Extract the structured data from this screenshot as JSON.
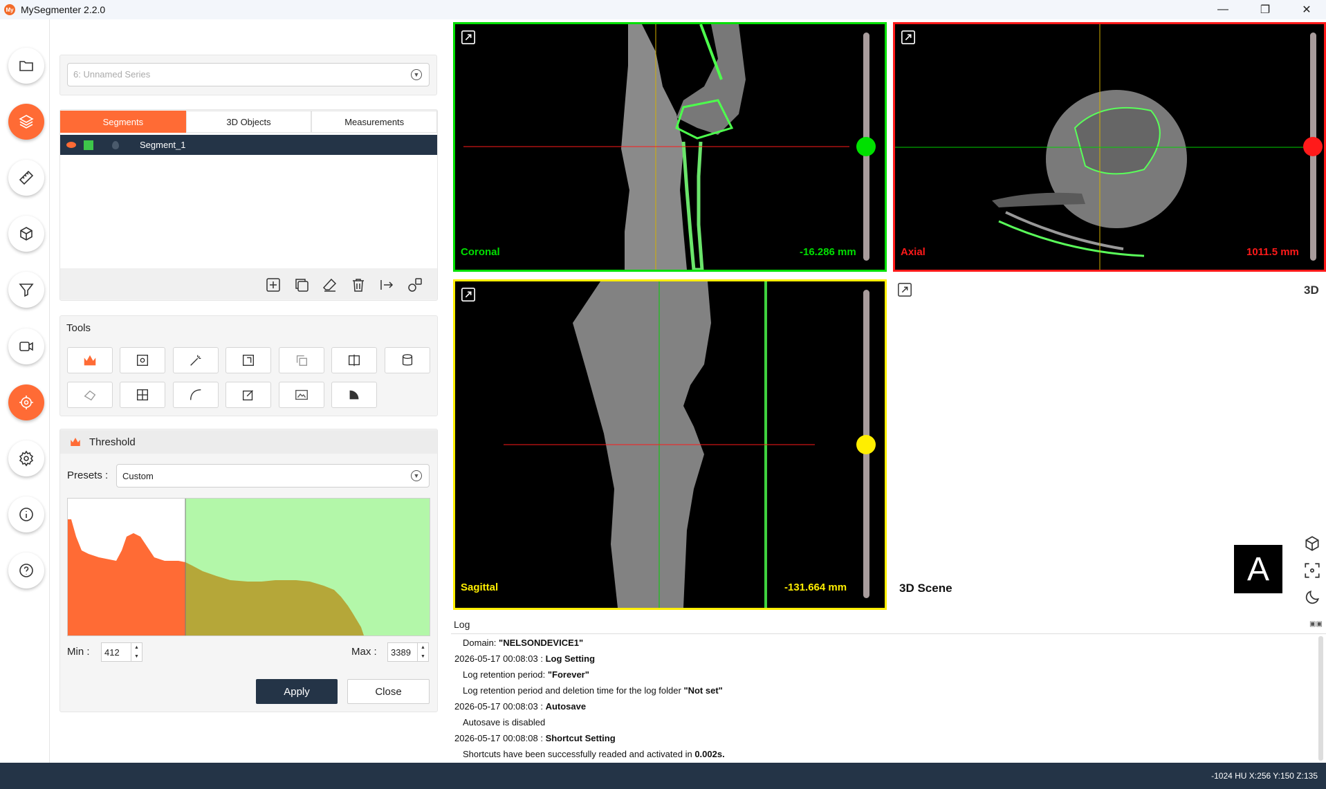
{
  "app": {
    "logo_text": "My",
    "title": "MySegmenter 2.2.0"
  },
  "window_controls": {
    "minimize": "—",
    "maximize": "❐",
    "close": "✕"
  },
  "nav": {
    "items": [
      {
        "name": "folder-icon",
        "active": false
      },
      {
        "name": "layers-icon",
        "active": true
      },
      {
        "name": "ruler-icon",
        "active": false
      },
      {
        "name": "cube-icon",
        "active": false
      },
      {
        "name": "filter-icon",
        "active": false
      },
      {
        "name": "video-camera-icon",
        "active": false
      },
      {
        "name": "target-icon",
        "active": true
      },
      {
        "name": "gear-icon",
        "active": false
      },
      {
        "name": "info-icon",
        "active": false
      },
      {
        "name": "help-icon",
        "active": false
      }
    ]
  },
  "series": {
    "selected": "6: Unnamed Series"
  },
  "tabs": [
    {
      "label": "Segments",
      "active": true
    },
    {
      "label": "3D Objects",
      "active": false
    },
    {
      "label": "Measurements",
      "active": false
    }
  ],
  "segments": [
    {
      "name": "Segment_1",
      "color": "#3ec64a",
      "visible": true
    }
  ],
  "tools": {
    "title": "Tools"
  },
  "threshold": {
    "title": "Threshold",
    "presets_label": "Presets :",
    "preset_value": "Custom",
    "min_label": "Min :",
    "min_value": "412",
    "max_label": "Max :",
    "max_value": "3389",
    "apply_label": "Apply",
    "close_label": "Close"
  },
  "colors": {
    "accent": "#ff6b35",
    "dark": "#243447",
    "coronal": "#00e000",
    "axial": "#ff1a1a",
    "sagittal": "#ffee00",
    "hist_selected": "#b3f7a9",
    "hist_curve_out": "#ff6b35",
    "hist_curve_in": "#b5a739"
  },
  "viewports": {
    "coronal": {
      "label": "Coronal",
      "position": "-16.286 mm",
      "slider_level": 0.47
    },
    "axial": {
      "label": "Axial",
      "position": "1011.5 mm",
      "slider_level": 0.47
    },
    "sagittal": {
      "label": "Sagittal",
      "position": "-131.664 mm",
      "slider_level": 0.5
    },
    "scene3d": {
      "badge": "3D",
      "label": "3D Scene",
      "orientation": "A"
    }
  },
  "log": {
    "title": "Log",
    "lines": [
      {
        "indent": true,
        "text": "Domain: ",
        "bold": "\"NELSONDEVICE1\""
      },
      {
        "indent": false,
        "text": "2026-05-17 00:08:03 : ",
        "bold": "Log Setting"
      },
      {
        "indent": true,
        "text": "Log retention period: ",
        "bold": "\"Forever\""
      },
      {
        "indent": true,
        "text": "Log retention period and deletion time for the log folder ",
        "bold": "\"Not set\""
      },
      {
        "indent": false,
        "text": "2026-05-17 00:08:03 : ",
        "bold": "Autosave"
      },
      {
        "indent": true,
        "text": "Autosave is disabled",
        "bold": ""
      },
      {
        "indent": false,
        "text": "2026-05-17 00:08:08 : ",
        "bold": "Shortcut Setting"
      },
      {
        "indent": true,
        "text": "Shortcuts have been successfully readed and activated in ",
        "bold": "0.002s."
      }
    ]
  },
  "status": {
    "text": "-1024 HU  X:256 Y:150 Z:135"
  }
}
